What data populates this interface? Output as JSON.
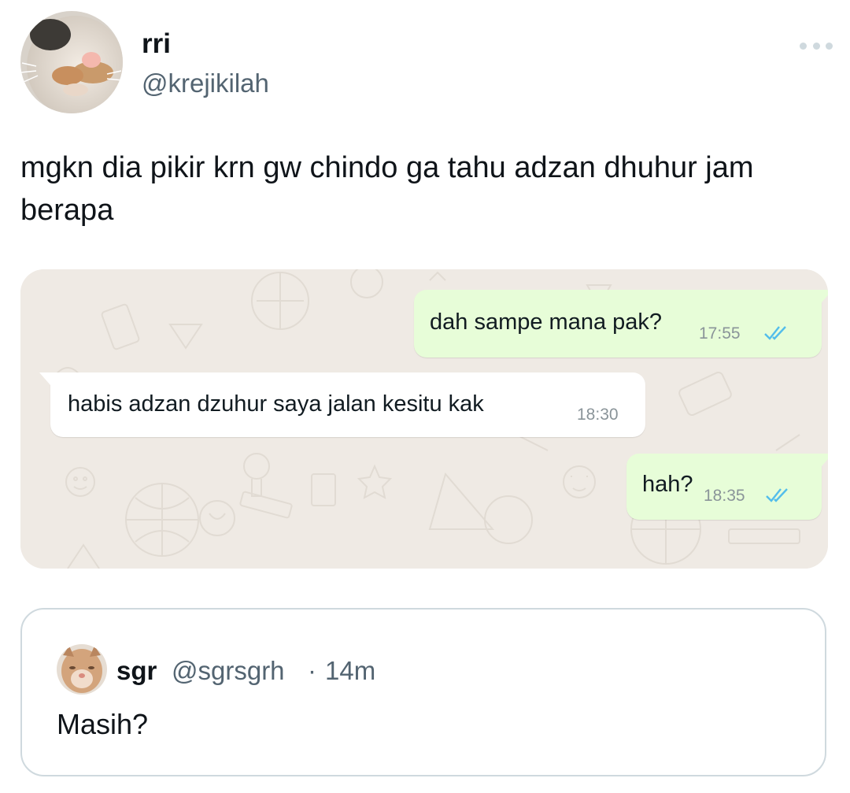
{
  "tweet": {
    "display_name": "rri",
    "handle": "@krejikilah",
    "avatar_icon": "cat-avatar-icon",
    "more_icon": "more-options-icon",
    "text": "mgkn dia pikir krn gw chindo ga tahu adzan dhuhur jam berapa"
  },
  "chat": {
    "background_color": "#efeae4",
    "outgoing_color": "#e7fdd8",
    "incoming_color": "#ffffff",
    "read_check_color": "#53bdeb",
    "messages": [
      {
        "direction": "outgoing",
        "text": "dah sampe mana pak?",
        "time": "17:55",
        "status": "read"
      },
      {
        "direction": "incoming",
        "text": "habis adzan dzuhur saya jalan kesitu kak",
        "time": "18:30"
      },
      {
        "direction": "outgoing",
        "text": "hah?",
        "time": "18:35",
        "status": "read"
      }
    ]
  },
  "quote": {
    "display_name": "sgr",
    "handle": "@sgrsgrh",
    "separator": "·",
    "time": "14m",
    "avatar_icon": "cat-avatar-icon",
    "text": "Masih?"
  },
  "colors": {
    "text_primary": "#0f1419",
    "text_secondary": "#536471",
    "border": "#cfd9de"
  }
}
